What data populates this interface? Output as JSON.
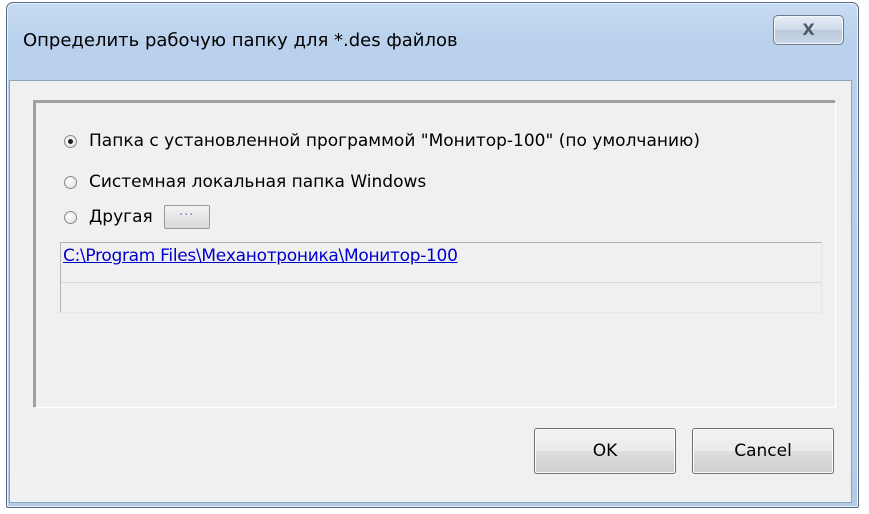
{
  "window": {
    "title": "Определить рабочую папку для *.des файлов",
    "close_label": "X"
  },
  "options": [
    {
      "label": "Папка с установленной программой \"Монитор-100\" (по умолчанию)",
      "checked": true
    },
    {
      "label": "Системная локальная папка Windows",
      "checked": false
    },
    {
      "label": "Другая",
      "checked": false
    }
  ],
  "browse_label": "···",
  "path": "C:\\Program Files\\Механотроника\\Монитор-100",
  "buttons": {
    "ok": "OK",
    "cancel": "Cancel"
  },
  "colors": {
    "frame": "#b9d1ec",
    "client": "#f0f0f0",
    "link": "#0000cc"
  }
}
